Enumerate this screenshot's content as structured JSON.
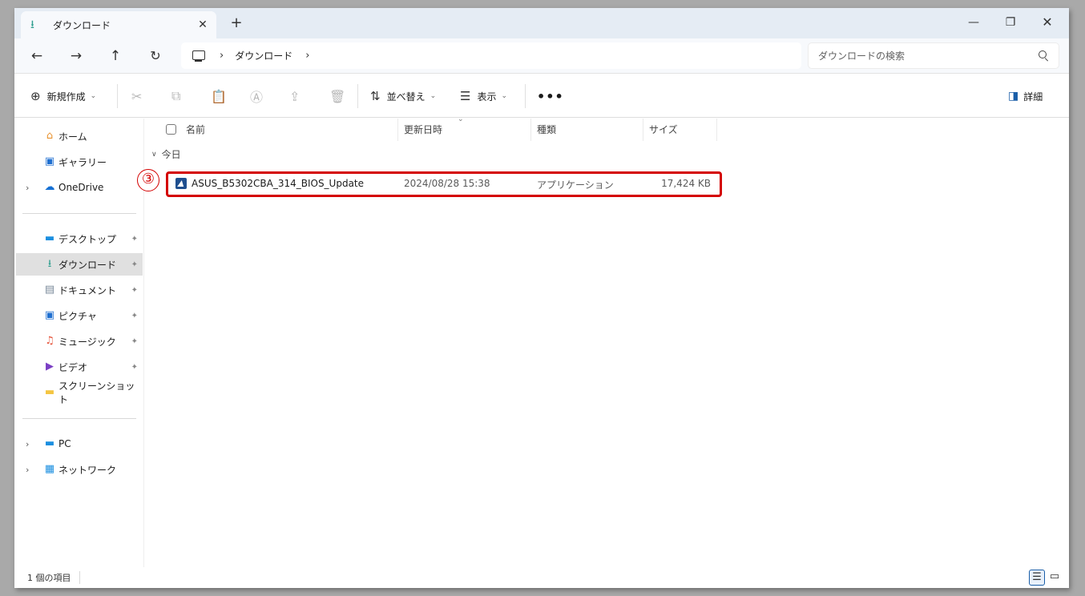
{
  "tab": {
    "label": "ダウンロード",
    "icon": "download-arrow-icon",
    "close": "✕",
    "new_tab": "+"
  },
  "window_controls": {
    "minimize": "—",
    "maximize": "❐",
    "close": "✕"
  },
  "nav": {
    "back": "←",
    "forward": "→",
    "up": "↑",
    "refresh": "↻"
  },
  "address": {
    "breadcrumb": [
      "ダウンロード"
    ],
    "separator": "›"
  },
  "search": {
    "placeholder": "ダウンロードの検索"
  },
  "toolbar": {
    "new_label": "新規作成",
    "sort_label": "並べ替え",
    "view_label": "表示",
    "more_label": "•••",
    "details_label": "詳細",
    "chevron": "⌄",
    "icons": [
      "cut-icon",
      "copy-icon",
      "paste-icon",
      "rename-icon",
      "share-icon",
      "delete-icon"
    ]
  },
  "sidebar": {
    "quick": [
      {
        "label": "ホーム",
        "icon": "home-icon",
        "color": "#e8922e"
      },
      {
        "label": "ギャラリー",
        "icon": "gallery-icon",
        "color": "#1f6fd0"
      },
      {
        "label": "OneDrive",
        "icon": "cloud-icon",
        "color": "#1570d4",
        "expandable": true
      }
    ],
    "pinned": [
      {
        "label": "デスクトップ",
        "icon": "desktop-icon",
        "color": "#1b8fe0"
      },
      {
        "label": "ダウンロード",
        "icon": "download-arrow-icon",
        "color": "#2f9e8f",
        "selected": true
      },
      {
        "label": "ドキュメント",
        "icon": "document-icon",
        "color": "#7a8a9a"
      },
      {
        "label": "ピクチャ",
        "icon": "pictures-icon",
        "color": "#1f6fd0"
      },
      {
        "label": "ミュージック",
        "icon": "music-icon",
        "color": "#e5533a"
      },
      {
        "label": "ビデオ",
        "icon": "video-icon",
        "color": "#7b3fc4"
      },
      {
        "label": "スクリーンショット",
        "icon": "folder-icon",
        "color": "#f4c542",
        "pinned": false
      }
    ],
    "devices": [
      {
        "label": "PC",
        "icon": "pc-icon",
        "color": "#1b8fe0"
      },
      {
        "label": "ネットワーク",
        "icon": "network-icon",
        "color": "#1b8fe0"
      }
    ],
    "expand_glyph": "›",
    "pin_glyph": "📌"
  },
  "columns": {
    "name": "名前",
    "date": "更新日時",
    "type": "種類",
    "size": "サイズ"
  },
  "group": {
    "label": "今日"
  },
  "files": [
    {
      "name": "ASUS_B5302CBA_314_BIOS_Update",
      "date": "2024/08/28 15:38",
      "type": "アプリケーション",
      "size": "17,424 KB"
    }
  ],
  "annotation": {
    "step": "③",
    "color": "#d40000"
  },
  "status": {
    "count": "1 個の項目"
  }
}
